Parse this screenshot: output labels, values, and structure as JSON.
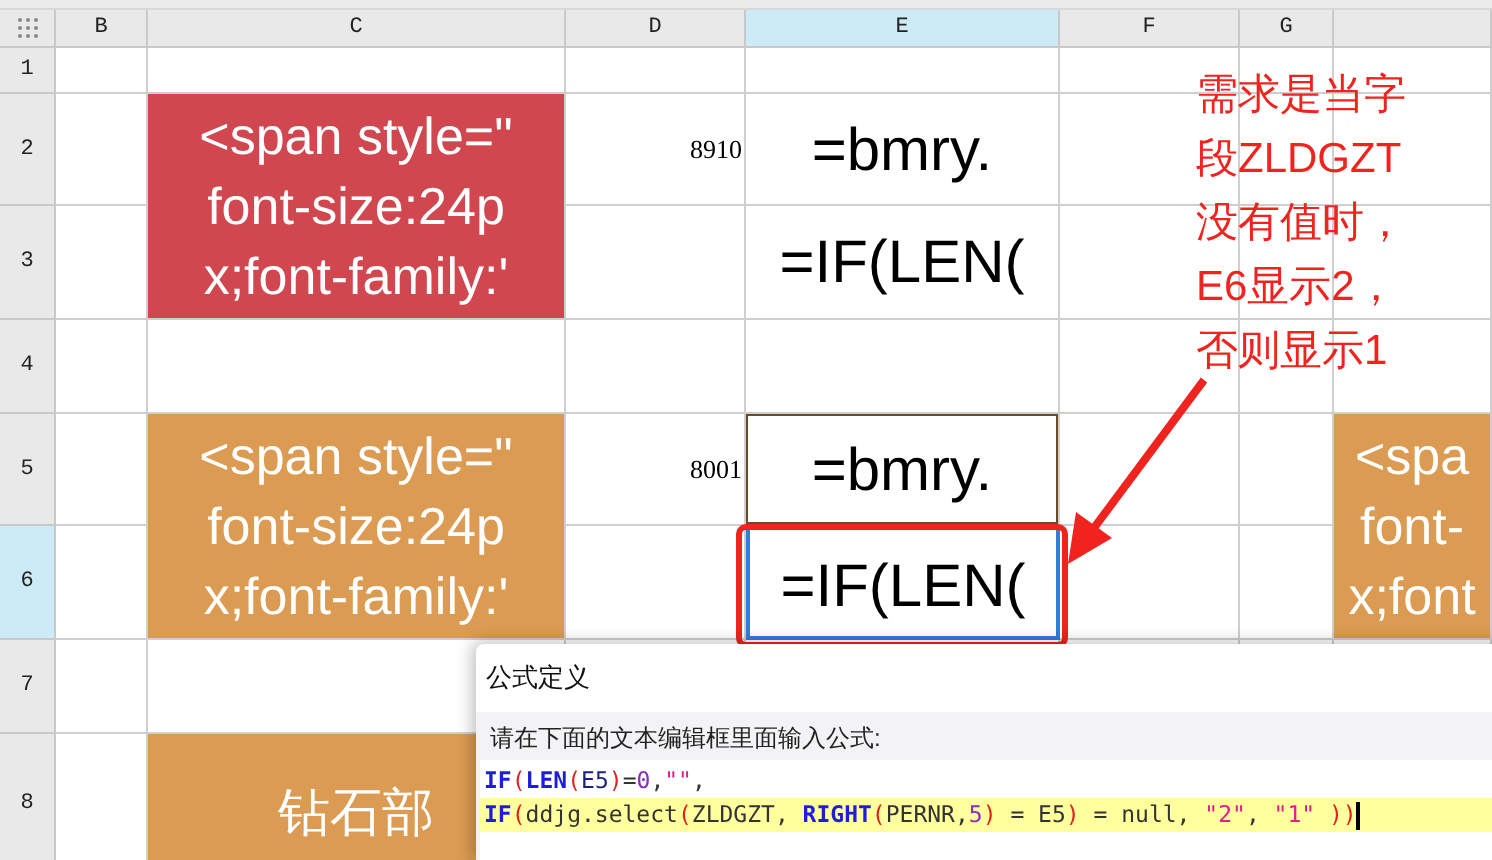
{
  "columns": [
    {
      "label": "B",
      "selected": false
    },
    {
      "label": "C",
      "selected": false
    },
    {
      "label": "D",
      "selected": false
    },
    {
      "label": "E",
      "selected": true
    },
    {
      "label": "F",
      "selected": false
    },
    {
      "label": "G",
      "selected": false
    }
  ],
  "rows": [
    {
      "label": "1",
      "selected": false,
      "cells": [
        {
          "kind": "empty"
        },
        {
          "kind": "empty"
        },
        {
          "kind": "empty"
        },
        {
          "kind": "empty"
        },
        {
          "kind": "empty"
        },
        {
          "kind": "empty"
        },
        {
          "kind": "empty"
        }
      ]
    },
    {
      "label": "2",
      "selected": false,
      "cells": [
        {
          "kind": "empty"
        },
        {
          "kind": "banner",
          "color": "#d1474f",
          "merged_down": true,
          "lines": [
            "<span style=\"",
            "font-size:24p",
            "x;font-family:'"
          ]
        },
        {
          "kind": "number",
          "text": "8910"
        },
        {
          "kind": "formula",
          "outlined": false,
          "selected": false,
          "lines": [
            "=bmry."
          ]
        },
        {
          "kind": "empty"
        },
        {
          "kind": "empty"
        },
        {
          "kind": "empty"
        }
      ]
    },
    {
      "label": "3",
      "selected": false,
      "cells": [
        {
          "kind": "empty"
        },
        {
          "kind": "covered"
        },
        {
          "kind": "empty"
        },
        {
          "kind": "formula",
          "outlined": false,
          "selected": false,
          "lines": [
            "=IF(LEN("
          ]
        },
        {
          "kind": "empty"
        },
        {
          "kind": "empty"
        },
        {
          "kind": "empty"
        }
      ]
    },
    {
      "label": "4",
      "selected": false,
      "cells": [
        {
          "kind": "empty"
        },
        {
          "kind": "empty"
        },
        {
          "kind": "empty"
        },
        {
          "kind": "empty"
        },
        {
          "kind": "empty"
        },
        {
          "kind": "empty"
        },
        {
          "kind": "empty"
        }
      ]
    },
    {
      "label": "5",
      "selected": false,
      "cells": [
        {
          "kind": "empty"
        },
        {
          "kind": "banner",
          "color": "#dc9b52",
          "merged_down": true,
          "lines": [
            "<span style=\"",
            "font-size:24p",
            "x;font-family:'"
          ]
        },
        {
          "kind": "number",
          "text": "8001"
        },
        {
          "kind": "formula",
          "outlined": true,
          "selected": false,
          "lines": [
            "=bmry."
          ]
        },
        {
          "kind": "empty"
        },
        {
          "kind": "empty"
        },
        {
          "kind": "banner",
          "color": "#dc9b52",
          "merged_down": true,
          "lines": [
            "<spa",
            "font-",
            "x;font"
          ]
        }
      ]
    },
    {
      "label": "6",
      "selected": true,
      "cells": [
        {
          "kind": "empty"
        },
        {
          "kind": "covered"
        },
        {
          "kind": "empty"
        },
        {
          "kind": "formula",
          "outlined": false,
          "selected": true,
          "lines": [
            "=IF(LEN("
          ]
        },
        {
          "kind": "empty"
        },
        {
          "kind": "empty"
        },
        {
          "kind": "covered"
        }
      ]
    },
    {
      "label": "7",
      "selected": false,
      "cells": [
        {
          "kind": "empty"
        },
        {
          "kind": "empty"
        },
        {
          "kind": "empty"
        },
        {
          "kind": "empty"
        },
        {
          "kind": "empty"
        },
        {
          "kind": "empty"
        },
        {
          "kind": "empty"
        }
      ]
    },
    {
      "label": "8",
      "selected": false,
      "cells": [
        {
          "kind": "empty"
        },
        {
          "kind": "banner",
          "color": "#dc9b52",
          "merged_down": false,
          "lines": [
            "钻石部"
          ]
        },
        {
          "kind": "empty"
        },
        {
          "kind": "empty"
        },
        {
          "kind": "empty"
        },
        {
          "kind": "empty"
        },
        {
          "kind": "empty"
        }
      ]
    }
  ],
  "annotation": {
    "lines": [
      "需求是当字",
      "段ZLDGZT",
      "没有值时，",
      "E6显示2，",
      "否则显示1"
    ]
  },
  "dialog": {
    "title": "公式定义",
    "instruction": "请在下面的文本编辑框里面输入公式:",
    "code_lines": [
      {
        "current": false,
        "tokens": [
          {
            "kind": "keyword",
            "text": "IF"
          },
          {
            "kind": "paren",
            "text": "("
          },
          {
            "kind": "keyword",
            "text": "LEN"
          },
          {
            "kind": "paren",
            "text": "("
          },
          {
            "kind": "ref",
            "text": "E5"
          },
          {
            "kind": "paren",
            "text": ")"
          },
          {
            "kind": "plain",
            "text": "="
          },
          {
            "kind": "number",
            "text": "0"
          },
          {
            "kind": "plain",
            "text": ","
          },
          {
            "kind": "string",
            "text": "\"\""
          },
          {
            "kind": "plain",
            "text": ","
          }
        ]
      },
      {
        "current": true,
        "tokens": [
          {
            "kind": "keyword",
            "text": "IF"
          },
          {
            "kind": "paren",
            "text": "("
          },
          {
            "kind": "plain",
            "text": "ddjg.select"
          },
          {
            "kind": "paren",
            "text": "("
          },
          {
            "kind": "plain",
            "text": "ZLDGZT, "
          },
          {
            "kind": "keyword",
            "text": "RIGHT"
          },
          {
            "kind": "paren",
            "text": "("
          },
          {
            "kind": "plain",
            "text": "PERNR,"
          },
          {
            "kind": "number",
            "text": "5"
          },
          {
            "kind": "paren",
            "text": ")"
          },
          {
            "kind": "plain",
            "text": " = E5"
          },
          {
            "kind": "paren",
            "text": ")"
          },
          {
            "kind": "plain",
            "text": " = null, "
          },
          {
            "kind": "string",
            "text": "\"2\""
          },
          {
            "kind": "plain",
            "text": ", "
          },
          {
            "kind": "string",
            "text": "\"1\""
          },
          {
            "kind": "paren",
            "text": " ))"
          }
        ]
      }
    ]
  }
}
